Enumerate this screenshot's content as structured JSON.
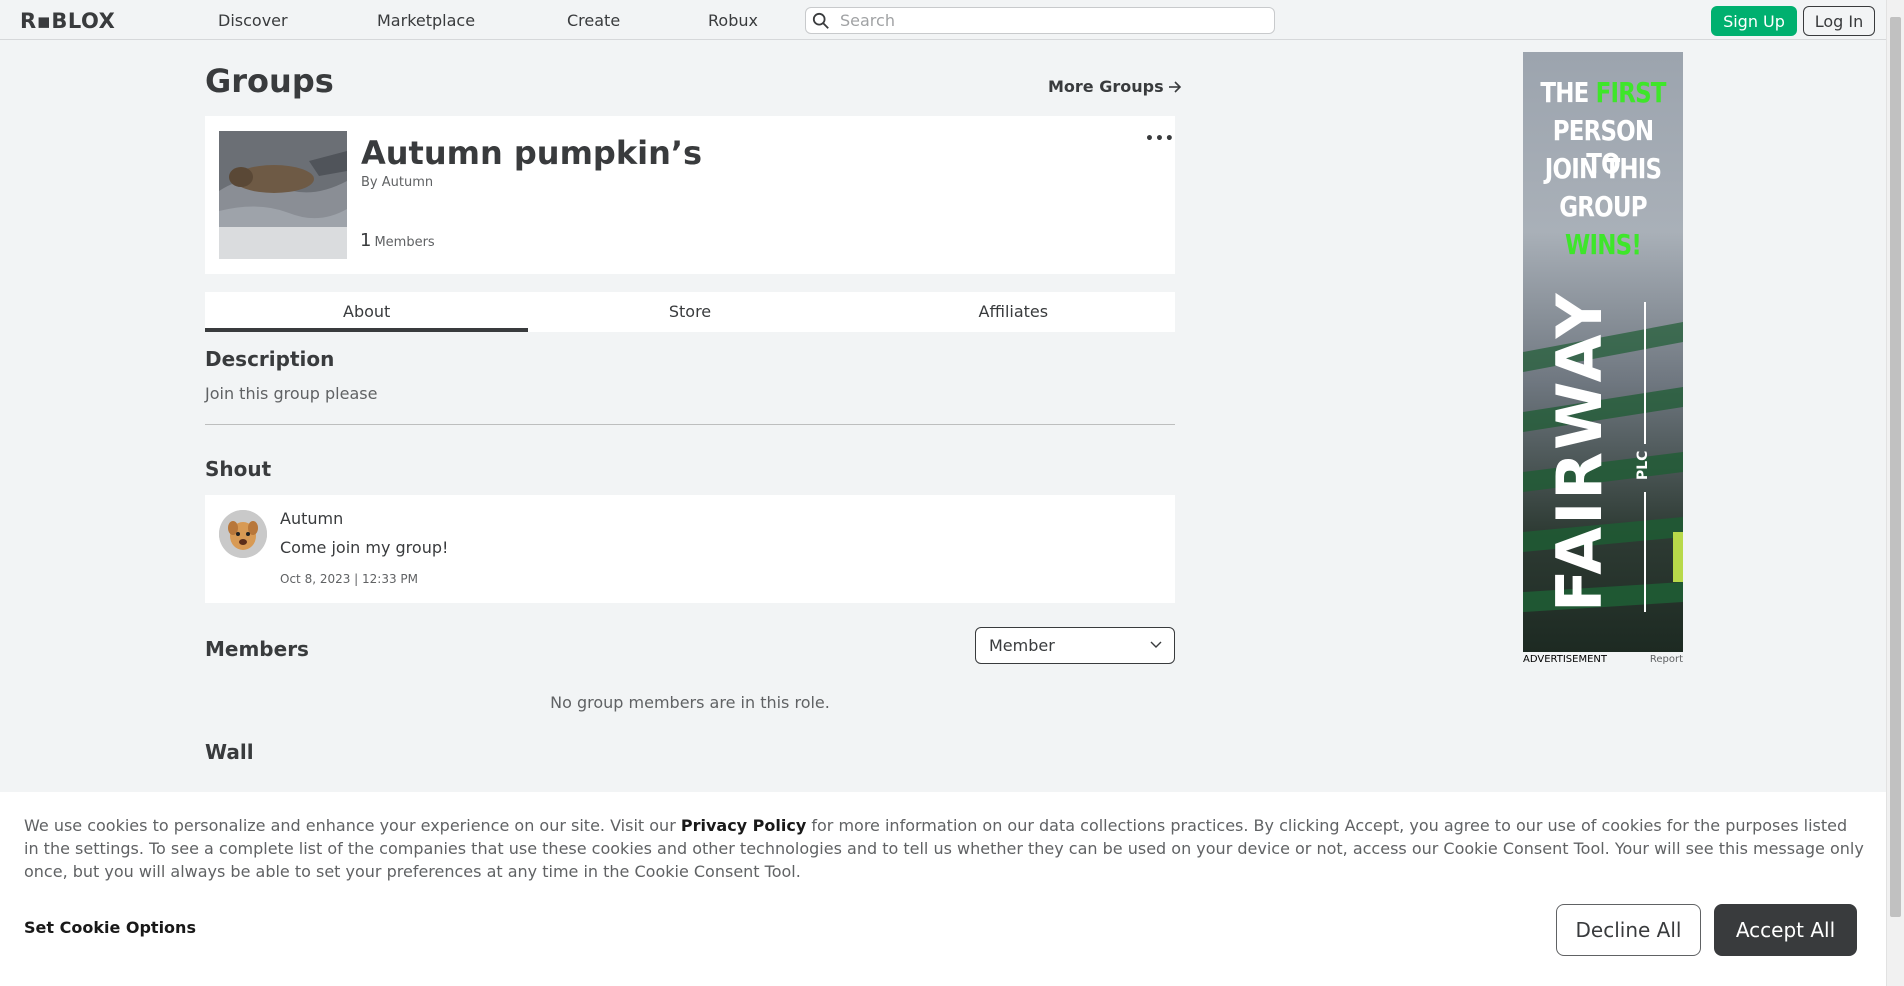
{
  "header": {
    "logo": "R▪BLOX",
    "nav": [
      "Discover",
      "Marketplace",
      "Create",
      "Robux"
    ],
    "search_placeholder": "Search",
    "signup_label": "Sign Up",
    "login_label": "Log In"
  },
  "page": {
    "title": "Groups",
    "more_groups": "More Groups"
  },
  "group": {
    "name": "Autumn pumpkin’s",
    "by_prefix": "By",
    "owner": "Autumn",
    "member_count": "1",
    "members_label": "Members",
    "more_menu": "•••"
  },
  "tabs": [
    "About",
    "Store",
    "Affiliates"
  ],
  "about": {
    "description_heading": "Description",
    "description": "Join this group please",
    "shout_heading": "Shout",
    "shout": {
      "author": "Autumn",
      "message": "Come join my group!",
      "time": "Oct 8, 2023 | 12:33 PM"
    },
    "members_heading": "Members",
    "role_selected": "Member",
    "empty_members": "No group members are in this role.",
    "wall_heading": "Wall"
  },
  "ad": {
    "line1_a": "THE ",
    "line1_b": "FIRST",
    "line2": "PERSON TO",
    "line3": "JOIN THIS",
    "line4": "GROUP",
    "line5": "WINS!",
    "brand": "FAIRWAY",
    "plc": "PLC",
    "label": "ADVERTISEMENT",
    "report": "Report"
  },
  "cookie": {
    "text_1": "We use cookies to personalize and enhance your experience on our site. Visit our ",
    "privacy_link": "Privacy Policy",
    "text_2": " for more information on our data collections practices. By clicking Accept, you agree to our use of cookies for the purposes listed in the settings. To see a complete list of the companies that use these cookies and other technologies and to tell us whether they can be used on your device or not, access our Cookie Consent Tool. Your will see this message only once, but you will always be able to set your preferences at any time in the Cookie Consent Tool.",
    "set_options": "Set Cookie Options",
    "decline": "Decline All",
    "accept": "Accept All"
  },
  "colors": {
    "signup": "#00b06f",
    "ad_green": "#3ee62a",
    "accept_bg": "#393b3d"
  }
}
